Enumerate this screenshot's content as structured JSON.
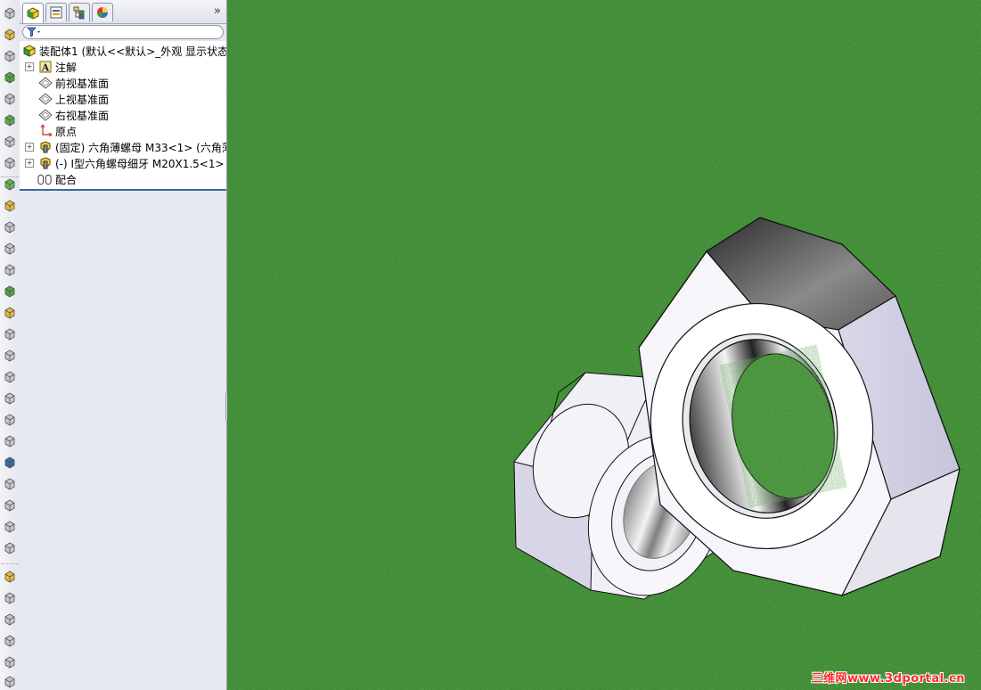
{
  "tabs": [
    {
      "name": "feature-manager-tab",
      "icon": "feature-manager-icon",
      "active": true
    },
    {
      "name": "property-manager-tab",
      "icon": "property-manager-icon",
      "active": false
    },
    {
      "name": "configuration-manager-tab",
      "icon": "configuration-manager-icon",
      "active": false
    },
    {
      "name": "display-manager-tab",
      "icon": "display-manager-icon",
      "active": false
    }
  ],
  "more_tabs_label": "»",
  "tree": {
    "root": "装配体1  (默认<<默认>_外观 显示状态",
    "items": [
      {
        "label": "注解",
        "icon": "annotation-icon",
        "expandable": true
      },
      {
        "label": "前视基准面",
        "icon": "plane-icon",
        "expandable": false
      },
      {
        "label": "上视基准面",
        "icon": "plane-icon",
        "expandable": false
      },
      {
        "label": "右视基准面",
        "icon": "plane-icon",
        "expandable": false
      },
      {
        "label": "原点",
        "icon": "origin-icon",
        "expandable": false
      },
      {
        "label": "(固定) 六角薄螺母 M33<1> (六角薄",
        "icon": "part-icon",
        "expandable": true
      },
      {
        "label": "(-) I型六角螺母细牙 M20X1.5<1>",
        "icon": "part-icon",
        "expandable": true
      },
      {
        "label": "配合",
        "icon": "mates-icon",
        "expandable": false
      }
    ]
  },
  "watermark": "三维网www.3dportal.cn",
  "colors": {
    "viewport_green": "#3f8a31",
    "selection_blue": "#3a68a6",
    "watermark_red": "#ff2a2a"
  }
}
